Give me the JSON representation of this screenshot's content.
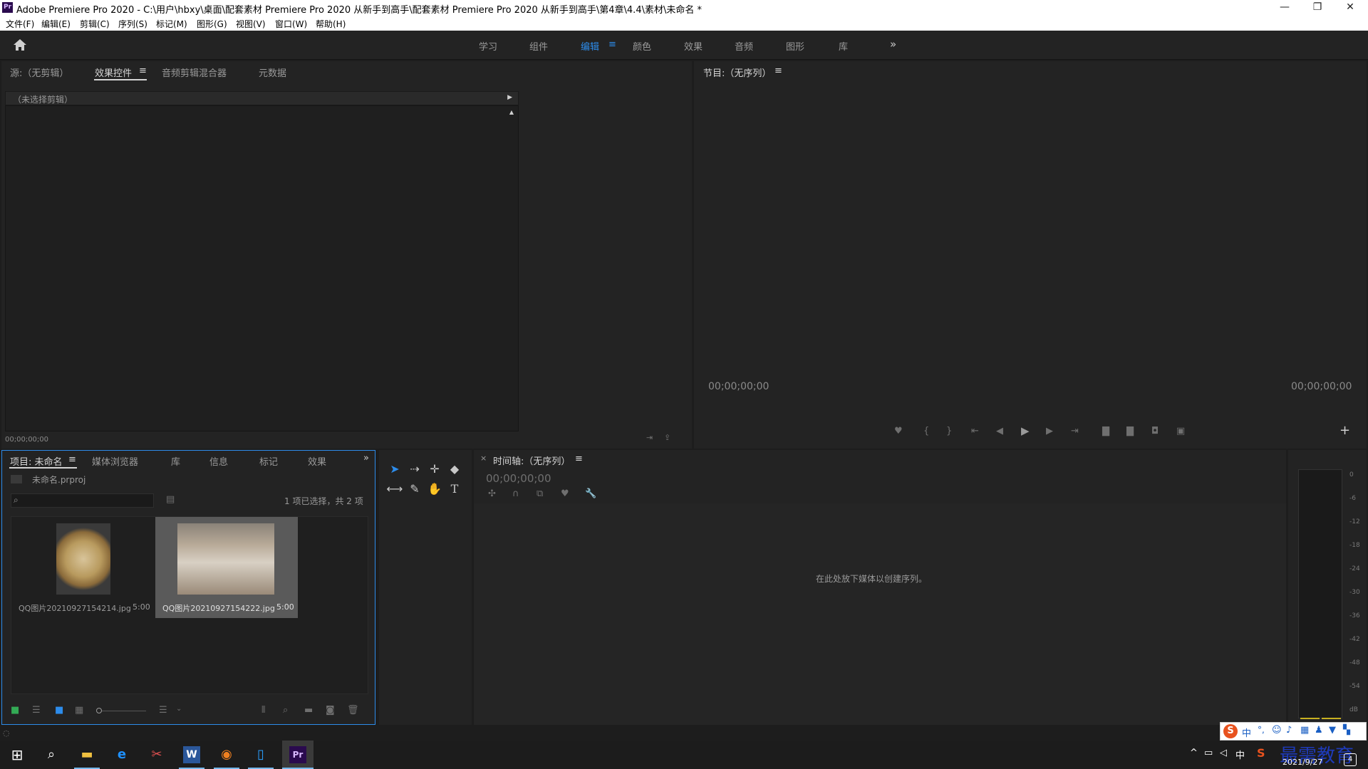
{
  "window": {
    "title": "Adobe Premiere Pro 2020 - C:\\用户\\hbxy\\桌面\\配套素材 Premiere Pro 2020 从新手到高手\\配套素材 Premiere Pro 2020 从新手到高手\\第4章\\4.4\\素材\\未命名 *",
    "app_icon": "Pr",
    "minimize": "—",
    "restore": "❐",
    "close": "✕"
  },
  "menu": {
    "items": [
      "文件(F)",
      "编辑(E)",
      "剪辑(C)",
      "序列(S)",
      "标记(M)",
      "图形(G)",
      "视图(V)",
      "窗口(W)",
      "帮助(H)"
    ]
  },
  "workspaces": {
    "items": [
      "学习",
      "组件",
      "编辑",
      "颜色",
      "效果",
      "音频",
      "图形",
      "库"
    ],
    "active": "编辑",
    "menu_glyph": "≡",
    "more": "»"
  },
  "source_panel": {
    "tabs": [
      "源:（无剪辑）",
      "效果控件",
      "音频剪辑混合器",
      "元数据"
    ],
    "active_tab": "效果控件",
    "tab_menu": "≡",
    "no_clip": "（未选择剪辑）",
    "timecode": "00;00;00;00"
  },
  "program_panel": {
    "title": "节目:（无序列）",
    "menu": "≡",
    "timecode_left": "00;00;00;00",
    "timecode_right": "00;00;00;00"
  },
  "project_panel": {
    "tabs": [
      "项目: 未命名",
      "媒体浏览器",
      "库",
      "信息",
      "标记",
      "效果"
    ],
    "active_tab": "项目: 未命名",
    "menu": "≡",
    "more": "»",
    "project_file": "未命名.prproj",
    "search_placeholder": "",
    "selection_info": "1 项已选择，共 2 项",
    "items": [
      {
        "name": "QQ图片20210927154214.jpg",
        "duration": "5:00",
        "selected": false
      },
      {
        "name": "QQ图片20210927154222.jpg",
        "duration": "5:00",
        "selected": true
      }
    ]
  },
  "timeline_panel": {
    "close": "×",
    "title": "时间轴:（无序列）",
    "menu": "≡",
    "timecode": "00;00;00;00",
    "drop_hint": "在此处放下媒体以创建序列。"
  },
  "audio_meter": {
    "labels": [
      "0",
      "-6",
      "-12",
      "-18",
      "-24",
      "-30",
      "-36",
      "-42",
      "-48",
      "-54",
      "dB"
    ]
  },
  "tray": {
    "ime": "中",
    "date": "2021/9/27",
    "watermark": "最需教育",
    "notif_count": "4"
  },
  "colors": {
    "accent": "#2d8ceb",
    "panel_bg": "#232323",
    "background": "#1d1d1d"
  }
}
